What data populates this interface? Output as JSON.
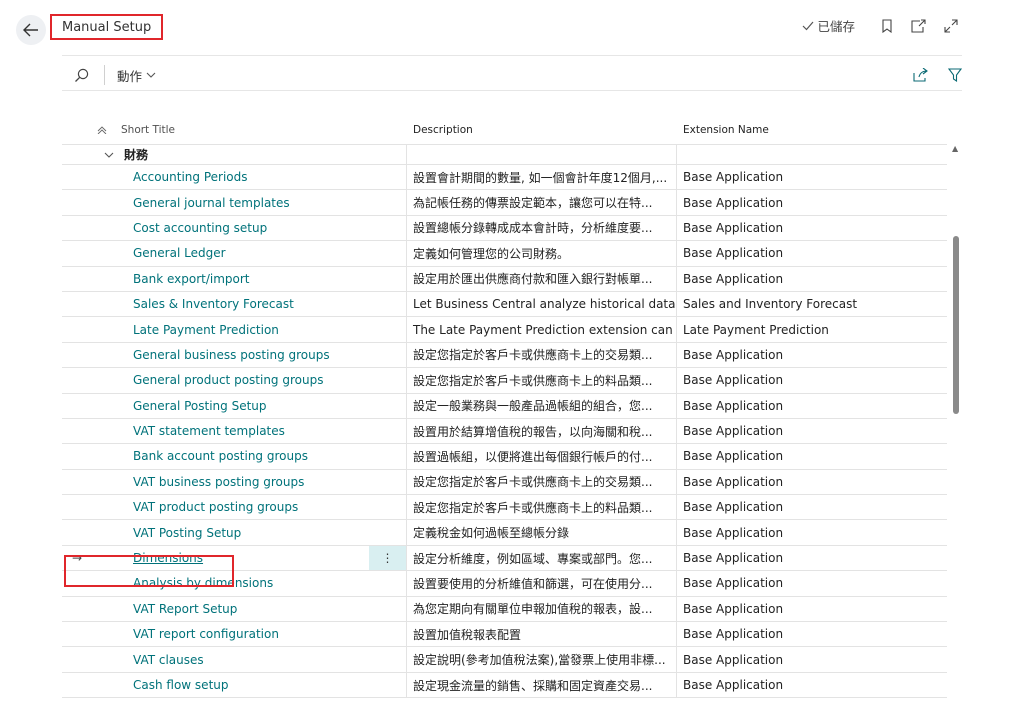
{
  "header": {
    "title": "Manual Setup",
    "saved_label": "已儲存",
    "icons": [
      "back-arrow-icon",
      "bookmark-icon",
      "open-new-window-icon",
      "expand-icon"
    ]
  },
  "toolbar": {
    "actions_label": "動作",
    "icons": [
      "search-icon",
      "share-icon",
      "filter-icon"
    ]
  },
  "grid": {
    "columns": [
      "Short Title",
      "Description",
      "Extension Name"
    ],
    "group_label": "財務",
    "rows": [
      {
        "title": "Accounting Periods",
        "description": "設置會計期間的數量, 如一個會計年度12個月,...",
        "extension": "Base Application"
      },
      {
        "title": "General journal templates",
        "description": "為記帳任務的傳票設定範本，讓您可以在特...",
        "extension": "Base Application"
      },
      {
        "title": "Cost accounting setup",
        "description": "設置總帳分錄轉成成本會計時，分析維度要...",
        "extension": "Base Application"
      },
      {
        "title": "General Ledger",
        "description": "定義如何管理您的公司財務。",
        "extension": "Base Application"
      },
      {
        "title": "Bank export/import",
        "description": "設定用於匯出供應商付款和匯入銀行對帳單...",
        "extension": "Base Application"
      },
      {
        "title": "Sales & Inventory Forecast",
        "description": "Let Business Central analyze historical data t...",
        "extension": "Sales and Inventory Forecast"
      },
      {
        "title": "Late Payment Prediction",
        "description": "The Late Payment Prediction extension can h...",
        "extension": "Late Payment Prediction"
      },
      {
        "title": "General business posting groups",
        "description": "設定您指定於客戶卡或供應商卡上的交易類...",
        "extension": "Base Application"
      },
      {
        "title": "General product posting groups",
        "description": "設定您指定於客戶卡或供應商卡上的料品類...",
        "extension": "Base Application"
      },
      {
        "title": "General Posting Setup",
        "description": "設定一般業務與一般產品過帳組的組合，您...",
        "extension": "Base Application"
      },
      {
        "title": "VAT statement templates",
        "description": "設置用於結算增值稅的報告，以向海關和稅...",
        "extension": "Base Application"
      },
      {
        "title": "Bank account posting groups",
        "description": "設置過帳組，以便將進出每個銀行帳戶的付...",
        "extension": "Base Application"
      },
      {
        "title": "VAT business posting groups",
        "description": "設定您指定於客戶卡或供應商卡上的交易類...",
        "extension": "Base Application"
      },
      {
        "title": "VAT product posting groups",
        "description": "設定您指定於客戶卡或供應商卡上的料品類...",
        "extension": "Base Application"
      },
      {
        "title": "VAT Posting Setup",
        "description": "定義稅金如何過帳至總帳分錄",
        "extension": "Base Application"
      },
      {
        "title": "Dimensions",
        "description": "設定分析維度，例如區域、專案或部門。您...",
        "extension": "Base Application",
        "selected": true
      },
      {
        "title": "Analysis by dimensions",
        "description": "設置要使用的分析維值和篩選，可在使用分...",
        "extension": "Base Application"
      },
      {
        "title": "VAT Report Setup",
        "description": "為您定期向有關單位申報加值稅的報表，設...",
        "extension": "Base Application"
      },
      {
        "title": "VAT report configuration",
        "description": "設置加值稅報表配置",
        "extension": "Base Application"
      },
      {
        "title": "VAT clauses",
        "description": "設定說明(參考加值稅法案),當發票上使用非標...",
        "extension": "Base Application"
      },
      {
        "title": "Cash flow setup",
        "description": "設定現金流量的銷售、採購和固定資產交易...",
        "extension": "Base Application"
      }
    ]
  },
  "colors": {
    "link": "#00727a",
    "highlight_border": "#e0262b",
    "selected_cell": "#d9eff1"
  }
}
